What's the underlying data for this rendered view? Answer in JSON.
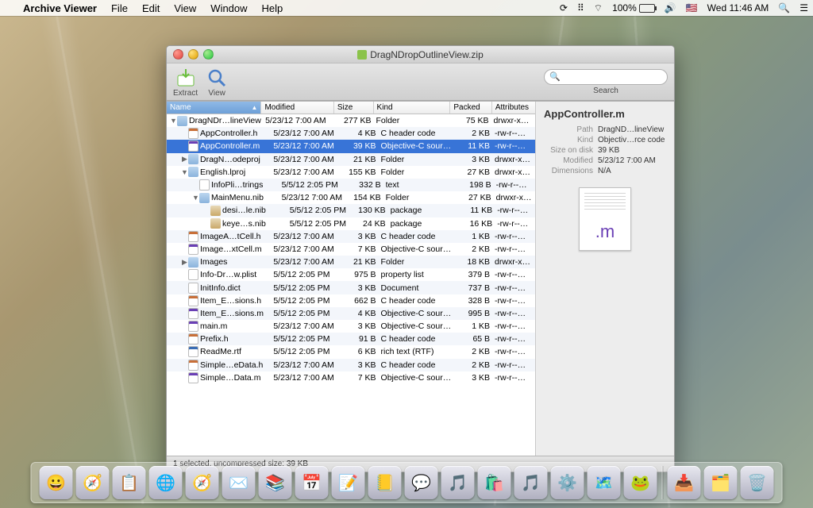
{
  "menubar": {
    "app_title": "Archive Viewer",
    "items": [
      "File",
      "Edit",
      "View",
      "Window",
      "Help"
    ],
    "battery": "100%",
    "clock": "Wed 11:46 AM"
  },
  "window": {
    "title": "DragNDropOutlineView.zip",
    "toolbar": {
      "extract": "Extract",
      "view": "View",
      "search_label": "Search",
      "search_placeholder": ""
    },
    "columns": [
      "Name",
      "Modified",
      "Size",
      "Kind",
      "Packed",
      "Attributes"
    ],
    "col_widths": {
      "name": 122,
      "mod": 91,
      "size": 45,
      "kind": 97,
      "pack": 48,
      "attr": 51
    },
    "status": "1 selected, uncompressed size: 39 KB",
    "rows": [
      {
        "d": 0,
        "e": "open",
        "i": "folder",
        "n": "DragNDr…lineView",
        "m": "5/23/12 7:00 AM",
        "s": "277 KB",
        "k": "Folder",
        "p": "75 KB",
        "a": "drwxr-x…"
      },
      {
        "d": 1,
        "e": "",
        "i": "h",
        "n": "AppController.h",
        "m": "5/23/12 7:00 AM",
        "s": "4 KB",
        "k": "C header code",
        "p": "2 KB",
        "a": "-rw-r--…"
      },
      {
        "d": 1,
        "e": "",
        "i": "m",
        "n": "AppController.m",
        "m": "5/23/12 7:00 AM",
        "s": "39 KB",
        "k": "Objective-C sourc…",
        "p": "11 KB",
        "a": "-rw-r--…",
        "sel": true
      },
      {
        "d": 1,
        "e": "closed",
        "i": "folder",
        "n": "DragN…odeproj",
        "m": "5/23/12 7:00 AM",
        "s": "21 KB",
        "k": "Folder",
        "p": "3 KB",
        "a": "drwxr-x…"
      },
      {
        "d": 1,
        "e": "open",
        "i": "folder",
        "n": "English.lproj",
        "m": "5/23/12 7:00 AM",
        "s": "155 KB",
        "k": "Folder",
        "p": "27 KB",
        "a": "drwxr-x…"
      },
      {
        "d": 2,
        "e": "",
        "i": "txt",
        "n": "InfoPli…trings",
        "m": "5/5/12 2:05 PM",
        "s": "332 B",
        "k": "text",
        "p": "198 B",
        "a": "-rw-r--…"
      },
      {
        "d": 2,
        "e": "open",
        "i": "folder",
        "n": "MainMenu.nib",
        "m": "5/23/12 7:00 AM",
        "s": "154 KB",
        "k": "Folder",
        "p": "27 KB",
        "a": "drwxr-x…"
      },
      {
        "d": 3,
        "e": "",
        "i": "pkg",
        "n": "desi…le.nib",
        "m": "5/5/12 2:05 PM",
        "s": "130 KB",
        "k": "package",
        "p": "11 KB",
        "a": "-rw-r--…"
      },
      {
        "d": 3,
        "e": "",
        "i": "pkg",
        "n": "keye…s.nib",
        "m": "5/5/12 2:05 PM",
        "s": "24 KB",
        "k": "package",
        "p": "16 KB",
        "a": "-rw-r--…"
      },
      {
        "d": 1,
        "e": "",
        "i": "h",
        "n": "ImageA…tCell.h",
        "m": "5/23/12 7:00 AM",
        "s": "3 KB",
        "k": "C header code",
        "p": "1 KB",
        "a": "-rw-r--…"
      },
      {
        "d": 1,
        "e": "",
        "i": "m",
        "n": "Image…xtCell.m",
        "m": "5/23/12 7:00 AM",
        "s": "7 KB",
        "k": "Objective-C sourc…",
        "p": "2 KB",
        "a": "-rw-r--…"
      },
      {
        "d": 1,
        "e": "closed",
        "i": "folder",
        "n": "Images",
        "m": "5/23/12 7:00 AM",
        "s": "21 KB",
        "k": "Folder",
        "p": "18 KB",
        "a": "drwxr-x…"
      },
      {
        "d": 1,
        "e": "",
        "i": "plist",
        "n": "Info-Dr…w.plist",
        "m": "5/5/12 2:05 PM",
        "s": "975 B",
        "k": "property list",
        "p": "379 B",
        "a": "-rw-r--…"
      },
      {
        "d": 1,
        "e": "",
        "i": "doc",
        "n": "InitInfo.dict",
        "m": "5/5/12 2:05 PM",
        "s": "3 KB",
        "k": "Document",
        "p": "737 B",
        "a": "-rw-r--…"
      },
      {
        "d": 1,
        "e": "",
        "i": "h",
        "n": "Item_E…sions.h",
        "m": "5/5/12 2:05 PM",
        "s": "662 B",
        "k": "C header code",
        "p": "328 B",
        "a": "-rw-r--…"
      },
      {
        "d": 1,
        "e": "",
        "i": "m",
        "n": "Item_E…sions.m",
        "m": "5/5/12 2:05 PM",
        "s": "4 KB",
        "k": "Objective-C sourc…",
        "p": "995 B",
        "a": "-rw-r--…"
      },
      {
        "d": 1,
        "e": "",
        "i": "m",
        "n": "main.m",
        "m": "5/23/12 7:00 AM",
        "s": "3 KB",
        "k": "Objective-C sourc…",
        "p": "1 KB",
        "a": "-rw-r--…"
      },
      {
        "d": 1,
        "e": "",
        "i": "h",
        "n": "Prefix.h",
        "m": "5/5/12 2:05 PM",
        "s": "91 B",
        "k": "C header code",
        "p": "65 B",
        "a": "-rw-r--…"
      },
      {
        "d": 1,
        "e": "",
        "i": "rtf",
        "n": "ReadMe.rtf",
        "m": "5/5/12 2:05 PM",
        "s": "6 KB",
        "k": "rich text (RTF)",
        "p": "2 KB",
        "a": "-rw-r--…"
      },
      {
        "d": 1,
        "e": "",
        "i": "h",
        "n": "Simple…eData.h",
        "m": "5/23/12 7:00 AM",
        "s": "3 KB",
        "k": "C header code",
        "p": "2 KB",
        "a": "-rw-r--…"
      },
      {
        "d": 1,
        "e": "",
        "i": "m",
        "n": "Simple…Data.m",
        "m": "5/23/12 7:00 AM",
        "s": "7 KB",
        "k": "Objective-C sourc…",
        "p": "3 KB",
        "a": "-rw-r--…"
      }
    ]
  },
  "info": {
    "title": "AppController.m",
    "path_k": "Path",
    "path_v": "DragND…lineView",
    "kind_k": "Kind",
    "kind_v": "Objectiv…rce code",
    "size_k": "Size on disk",
    "size_v": "39 KB",
    "mod_k": "Modified",
    "mod_v": "5/23/12 7:00 AM",
    "dim_k": "Dimensions",
    "dim_v": "N/A"
  },
  "dock": [
    "😀",
    "🧭",
    "📋",
    "🌐",
    "🧭",
    "✉️",
    "📚",
    "📅",
    "📝",
    "📒",
    "💬",
    "🎵",
    "🛍️",
    "🎵",
    "⚙️",
    "🗺️",
    "🐸"
  ]
}
